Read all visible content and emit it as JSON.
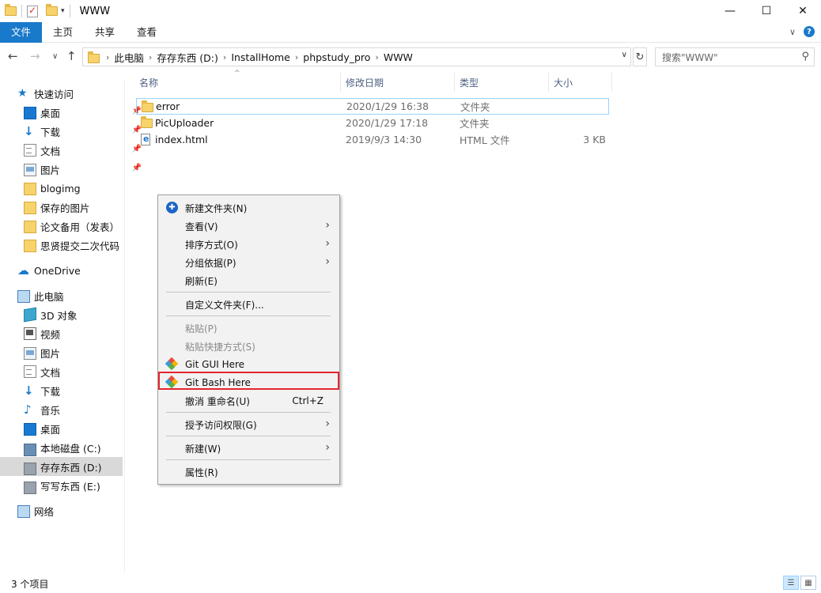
{
  "window": {
    "title": "WWW"
  },
  "ribbon": {
    "tabs": [
      "文件",
      "主页",
      "共享",
      "查看"
    ]
  },
  "address": {
    "crumbs": [
      "此电脑",
      "存存东西 (D:)",
      "InstallHome",
      "phpstudy_pro",
      "WWW"
    ]
  },
  "search": {
    "placeholder": "搜索\"WWW\""
  },
  "sidebar": {
    "quick_access": "快速访问",
    "quick_items": [
      "桌面",
      "下载",
      "文档",
      "图片",
      "blogimg",
      "保存的图片",
      "论文备用（发表）",
      "思贤提交二次代码"
    ],
    "onedrive": "OneDrive",
    "this_pc": "此电脑",
    "pc_items": [
      "3D 对象",
      "视频",
      "图片",
      "文档",
      "下载",
      "音乐",
      "桌面",
      "本地磁盘 (C:)",
      "存存东西 (D:)",
      "写写东西 (E:)"
    ],
    "network": "网络"
  },
  "columns": {
    "name": "名称",
    "date": "修改日期",
    "type": "类型",
    "size": "大小"
  },
  "files": [
    {
      "name": "error",
      "date": "2020/1/29 16:38",
      "type": "文件夹",
      "size": ""
    },
    {
      "name": "PicUploader",
      "date": "2020/1/29 17:18",
      "type": "文件夹",
      "size": ""
    },
    {
      "name": "index.html",
      "date": "2019/9/3 14:30",
      "type": "HTML 文件",
      "size": "3 KB"
    }
  ],
  "context_menu": {
    "new_folder": "新建文件夹(N)",
    "view": "查看(V)",
    "sort": "排序方式(O)",
    "group": "分组依据(P)",
    "refresh": "刷新(E)",
    "customize": "自定义文件夹(F)...",
    "paste": "粘贴(P)",
    "paste_shortcut": "粘贴快捷方式(S)",
    "git_gui": "Git GUI Here",
    "git_bash": "Git Bash Here",
    "undo": "撤消 重命名(U)",
    "undo_shortcut": "Ctrl+Z",
    "grant_access": "授予访问权限(G)",
    "new": "新建(W)",
    "properties": "属性(R)"
  },
  "status": {
    "count": "3 个项目"
  },
  "colors": {
    "accent": "#1979ca",
    "highlight_box": "#e4262f",
    "menu_bg": "#f2f2f2"
  }
}
